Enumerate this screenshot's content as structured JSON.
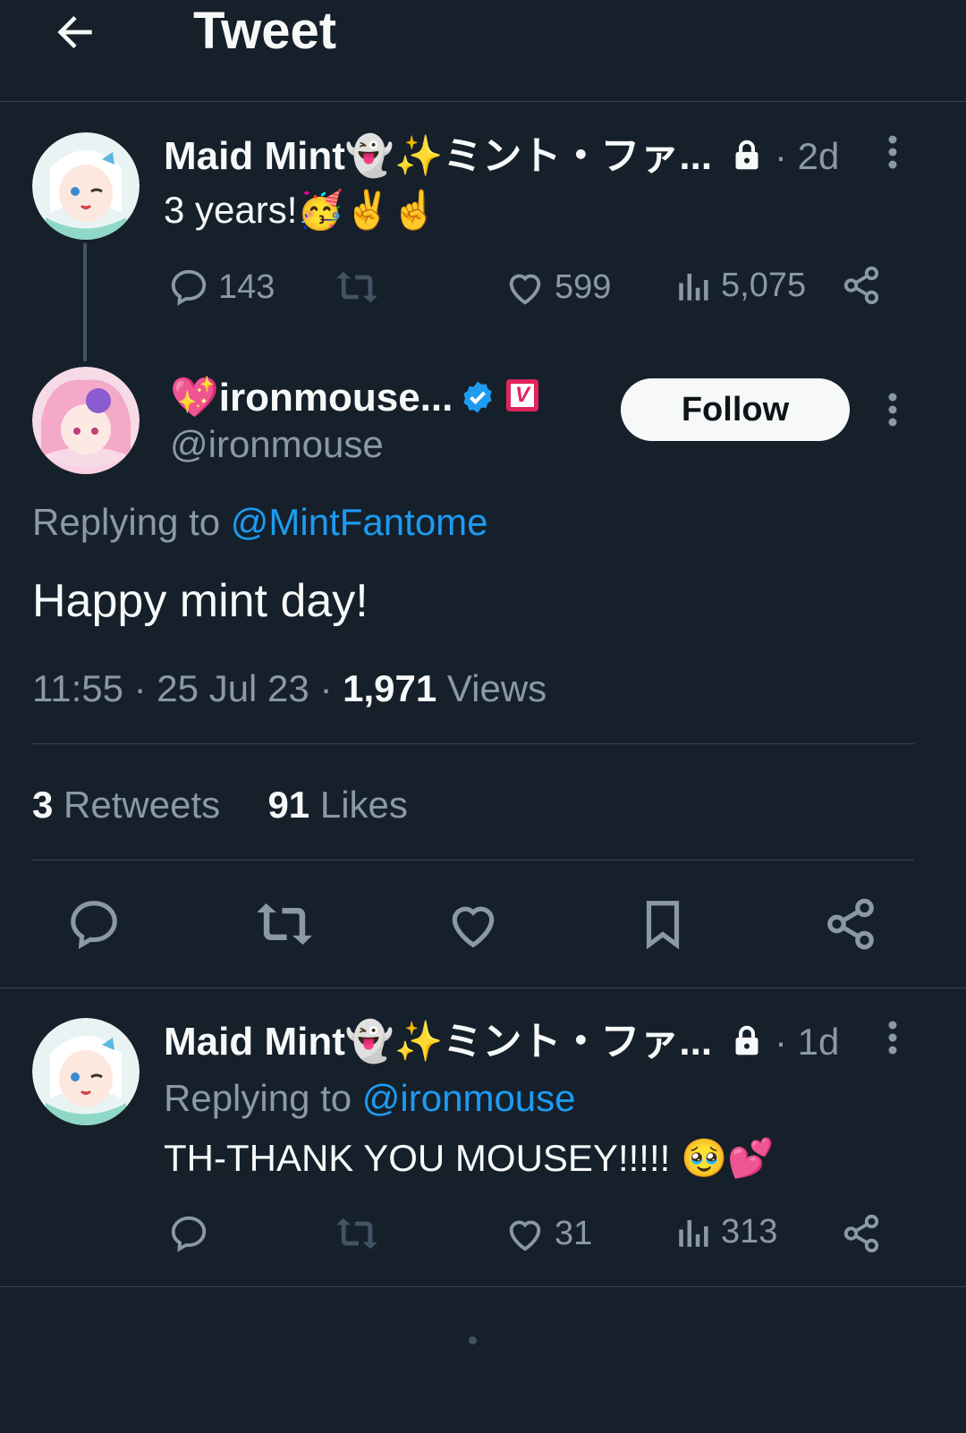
{
  "header": {
    "title": "Tweet"
  },
  "tweet1": {
    "name": "Maid Mint👻✨ミント・ファ...",
    "time": "· 2d",
    "text": "3 years!🥳✌️☝️",
    "stats": {
      "replies": "143",
      "likes": "599",
      "views": "5,075"
    }
  },
  "main": {
    "name": "💖ironmouse...",
    "handle": "@ironmouse",
    "badge_letter": "V",
    "follow_label": "Follow",
    "replying_prefix": "Replying to",
    "replying_handle": "@MintFantome",
    "text": "Happy mint day!",
    "time": "11:55 · 25 Jul 23 ·",
    "views_count": "1,971",
    "views_label": "Views",
    "retweets_count": "3",
    "retweets_label": "Retweets",
    "likes_count": "91",
    "likes_label": "Likes"
  },
  "tweet2": {
    "name": "Maid Mint👻✨ミント・ファ...",
    "time": "· 1d",
    "replying_prefix": "Replying to",
    "replying_handle": "@ironmouse",
    "text": "TH-THANK YOU MOUSEY!!!!! 🥹💕",
    "stats": {
      "likes": "31",
      "views": "313"
    }
  },
  "colors": {
    "background": "#15202b",
    "accent": "#1d9bf0",
    "muted": "#8b98a5",
    "divider": "#38444d"
  }
}
